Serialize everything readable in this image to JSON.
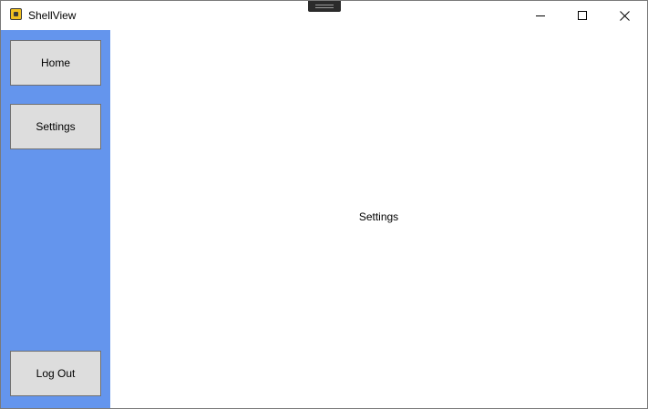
{
  "window": {
    "title": "ShellView"
  },
  "titlebar_buttons": {
    "minimize_icon": "minimize-icon",
    "maximize_icon": "maximize-icon",
    "close_icon": "close-icon"
  },
  "sidebar": {
    "background": "#6495ED",
    "home_label": "Home",
    "settings_label": "Settings",
    "logout_label": "Log Out"
  },
  "content": {
    "label": "Settings"
  }
}
